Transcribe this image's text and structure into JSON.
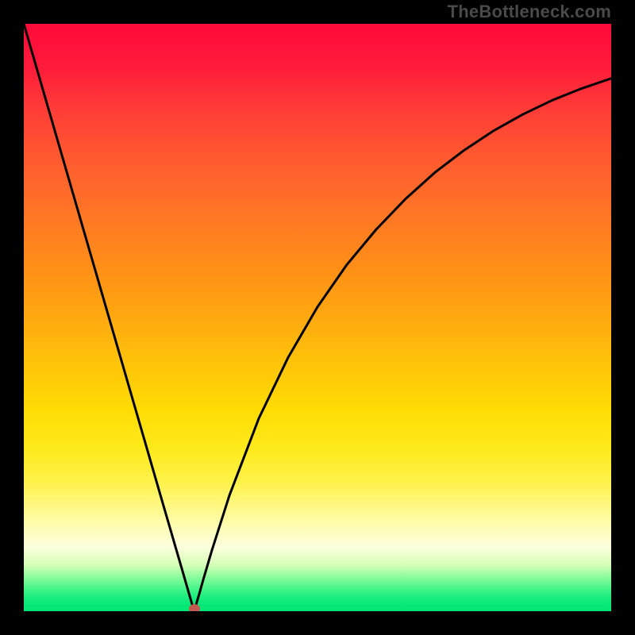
{
  "watermark": "TheBottleneck.com",
  "colors": {
    "background": "#000000",
    "curve": "#000000",
    "marker": "#c35a52"
  },
  "chart_data": {
    "type": "line",
    "title": "",
    "xlabel": "",
    "ylabel": "",
    "xlim": [
      0,
      1
    ],
    "ylim": [
      0,
      1
    ],
    "annotations": [
      "TheBottleneck.com"
    ],
    "marker": {
      "x": 0.29,
      "y": 0.0
    },
    "x": [
      0.0,
      0.04,
      0.08,
      0.12,
      0.16,
      0.2,
      0.24,
      0.27,
      0.285,
      0.29,
      0.3,
      0.305,
      0.32,
      0.35,
      0.4,
      0.45,
      0.5,
      0.55,
      0.6,
      0.65,
      0.7,
      0.75,
      0.8,
      0.85,
      0.9,
      0.95,
      1.0
    ],
    "values": [
      1.0,
      0.862,
      0.724,
      0.586,
      0.448,
      0.31,
      0.172,
      0.069,
      0.017,
      0.0,
      0.034,
      0.052,
      0.103,
      0.197,
      0.328,
      0.432,
      0.518,
      0.59,
      0.65,
      0.702,
      0.747,
      0.785,
      0.818,
      0.846,
      0.87,
      0.89,
      0.907
    ]
  }
}
